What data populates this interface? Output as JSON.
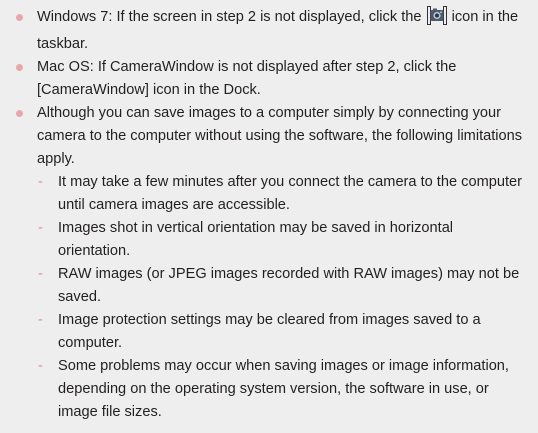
{
  "notes": {
    "windows": {
      "before_icon": "Windows 7: If the screen in step 2 is not displayed, click the ",
      "icon": "camera-icon",
      "after_icon": " icon in the taskbar."
    },
    "mac": "Mac OS: If CameraWindow is not displayed after step 2, click the [CameraWindow] icon in the Dock.",
    "limitations_intro": "Although you can save images to a computer simply by connecting your camera to the computer without using the software, the following limitations apply.",
    "dash": "-",
    "limitations": [
      "It may take a few minutes after you connect the camera to the computer until camera images are accessible.",
      "Images shot in vertical orientation may be saved in horizontal orientation.",
      "RAW images (or JPEG images recorded with RAW images) may not be saved.",
      "Image protection settings may be cleared from images saved to a computer.",
      "Some problems may occur when saving images or image information, depending on the operating system version, the software in use, or image file sizes."
    ]
  },
  "colors": {
    "background": "#eeeeef",
    "bullet": "#e9a7ab",
    "dash": "#d98f95",
    "text": "#231f20"
  }
}
